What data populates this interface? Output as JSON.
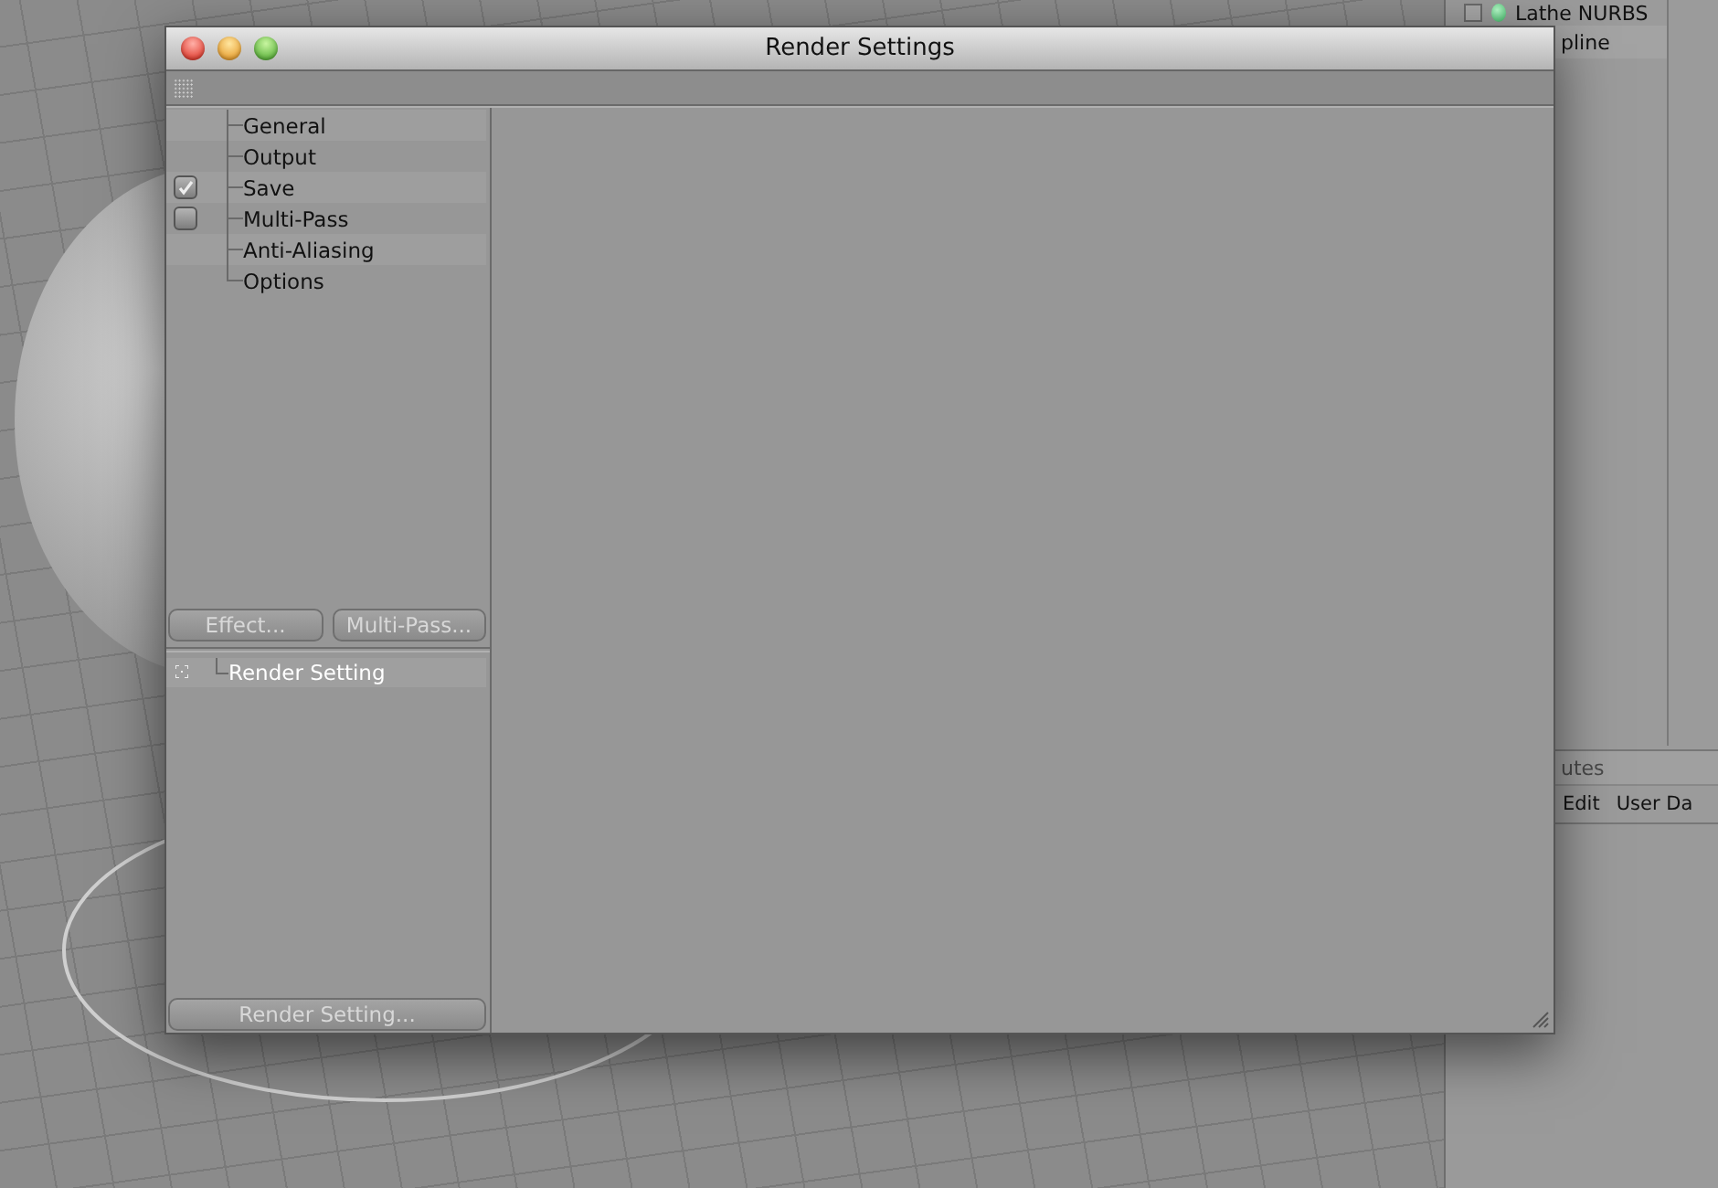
{
  "object_manager": {
    "objects": [
      {
        "name": "Lathe NURBS",
        "kind": "object",
        "checked": false
      },
      {
        "name": "pline",
        "kind": "child"
      }
    ],
    "attributes_title": "utes",
    "attributes_menu": [
      "Edit",
      "User Da"
    ]
  },
  "window": {
    "title": "Render Settings",
    "pages": [
      {
        "label": "General",
        "kind": "plain"
      },
      {
        "label": "Output",
        "kind": "plain"
      },
      {
        "label": "Save",
        "kind": "toggle",
        "checked": true
      },
      {
        "label": "Multi-Pass",
        "kind": "toggle",
        "checked": false
      },
      {
        "label": "Anti-Aliasing",
        "kind": "plain"
      },
      {
        "label": "Options",
        "kind": "plain"
      }
    ],
    "buttons": [
      "Effect...",
      "Multi-Pass..."
    ],
    "settings": [
      {
        "label": "Render Setting",
        "selected": true
      }
    ],
    "footer_button": "Render Setting..."
  }
}
